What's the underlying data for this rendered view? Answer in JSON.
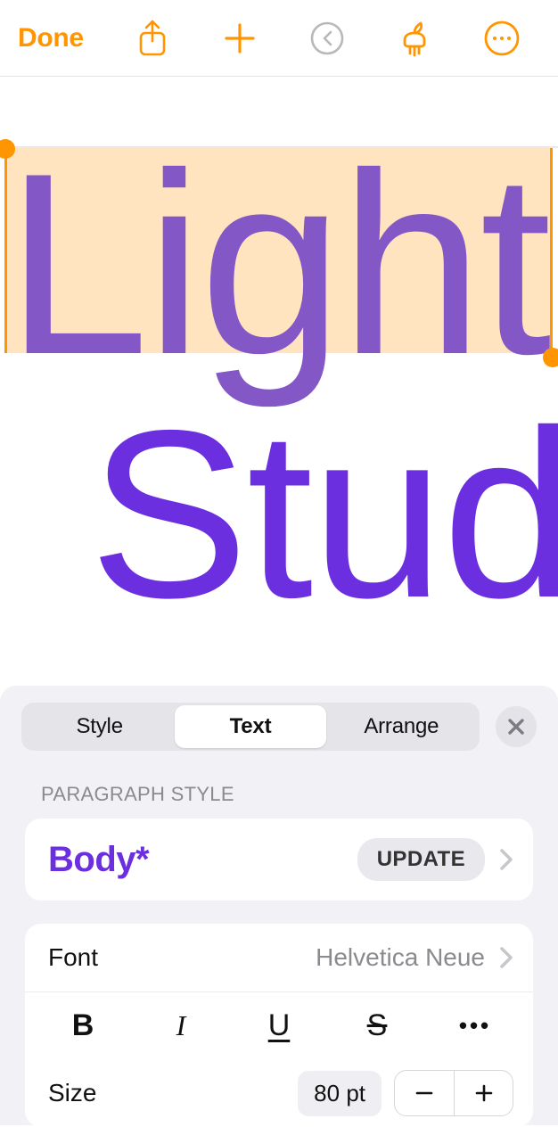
{
  "toolbar": {
    "done": "Done"
  },
  "canvas": {
    "line1": "Light",
    "line2": "Stud"
  },
  "panel": {
    "tabs": {
      "style": "Style",
      "text": "Text",
      "arrange": "Arrange",
      "active": "text"
    },
    "paragraph_style": {
      "section_label": "PARAGRAPH STYLE",
      "name": "Body*",
      "update_label": "UPDATE"
    },
    "font": {
      "label": "Font",
      "value": "Helvetica Neue"
    },
    "format": {
      "bold": "B",
      "italic": "I",
      "underline": "U",
      "strike": "S",
      "more": "•••"
    },
    "size": {
      "label": "Size",
      "value": "80 pt"
    }
  },
  "colors": {
    "accent": "#ff9500",
    "purple": "#6b2fe0"
  }
}
